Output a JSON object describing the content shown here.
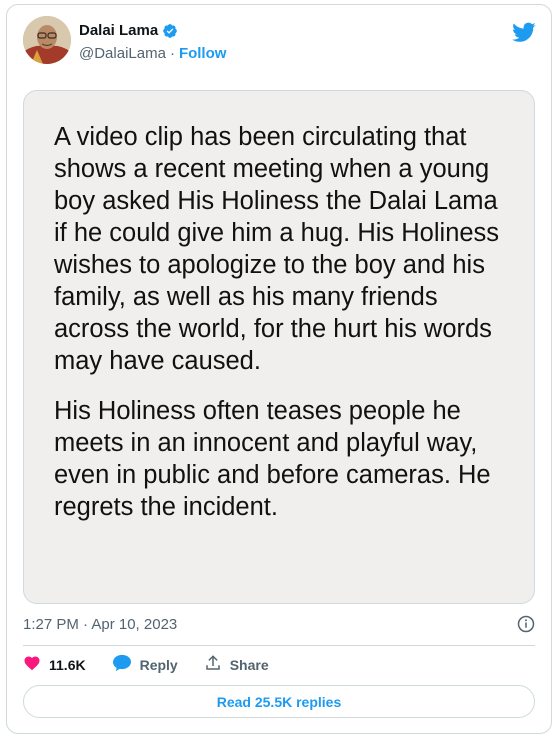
{
  "author": {
    "name": "Dalai Lama",
    "handle": "@DalaiLama",
    "separator": "·",
    "follow_label": "Follow"
  },
  "media_text": {
    "paragraph1": "A video clip has been circulating that shows a recent meeting when a young boy asked His Holiness the Dalai Lama if he could give him a hug. His Holiness wishes to apologize to the boy and his family, as well as his many friends across the world, for the hurt his words may have caused.",
    "paragraph2": "His Holiness often teases people he meets in an innocent and playful way, even in public and before cameras. He regrets the incident."
  },
  "timestamp": "1:27 PM · Apr 10, 2023",
  "actions": {
    "likes": "11.6K",
    "reply_label": "Reply",
    "share_label": "Share"
  },
  "read_replies_label": "Read 25.5K replies",
  "colors": {
    "accent": "#1d9bf0",
    "like": "#f91880",
    "muted": "#536471",
    "border": "#cfd9de"
  },
  "icons": [
    "verified-badge-icon",
    "twitter-bird-icon",
    "info-icon",
    "heart-icon",
    "reply-bubble-icon",
    "share-icon"
  ]
}
